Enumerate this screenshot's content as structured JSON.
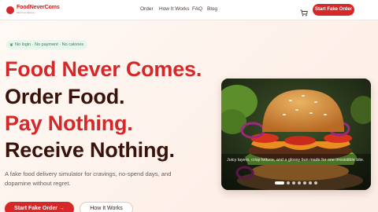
{
  "nav": {
    "logo_text": "FoodNeverComs",
    "logo_tag": "fake food delivery",
    "links": [
      {
        "label": "Order"
      },
      {
        "label": "How It Works"
      },
      {
        "label": "FAQ"
      },
      {
        "label": "Blog"
      }
    ],
    "cart_icon": "cart-icon",
    "cta": "Start Fake Order"
  },
  "badge": {
    "icon": "leaf-icon",
    "text": "No login · No payment · No calories"
  },
  "headlines": {
    "line1": "Food Never Comes.",
    "line2": "Order Food.",
    "line3": "Pay Nothing.",
    "line4": "Receive Nothing."
  },
  "description": "A fake food delivery simulator for cravings, no-spend days, and dopamine without regret.",
  "buttons": {
    "primary": "Start Fake Order →",
    "secondary": "How It Works"
  },
  "hero": {
    "caption": "Juicy layers, crisp lettuce, and a glossy bun made for one irresistible bite.",
    "slides": 7,
    "active_slide": 1
  },
  "colors": {
    "brand_red": "#d62828",
    "dark_brown": "#3a120a",
    "badge_green": "#2f8a4f"
  }
}
